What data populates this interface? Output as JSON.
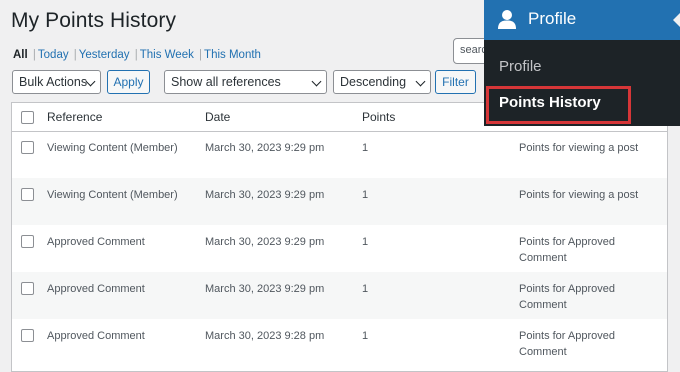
{
  "page": {
    "title": "My Points History"
  },
  "filters": {
    "current": "All",
    "links": [
      "Today",
      "Yesterday",
      "This Week",
      "This Month"
    ]
  },
  "search": {
    "placeholder": "search"
  },
  "toolbar": {
    "bulk_actions": "Bulk Actions",
    "apply": "Apply",
    "reference_filter": "Show all references",
    "order": "Descending",
    "filter": "Filter"
  },
  "table": {
    "columns": {
      "reference": "Reference",
      "date": "Date",
      "points": "Points"
    },
    "rows": [
      {
        "reference": "Viewing Content (Member)",
        "date": "March 30, 2023 9:29 pm",
        "points": "1",
        "desc": "Points for viewing a post"
      },
      {
        "reference": "Viewing Content (Member)",
        "date": "March 30, 2023 9:29 pm",
        "points": "1",
        "desc": "Points for viewing a post"
      },
      {
        "reference": "Approved Comment",
        "date": "March 30, 2023 9:29 pm",
        "points": "1",
        "desc": "Points for Approved Comment"
      },
      {
        "reference": "Approved Comment",
        "date": "March 30, 2023 9:29 pm",
        "points": "1",
        "desc": "Points for Approved Comment"
      },
      {
        "reference": "Approved Comment",
        "date": "March 30, 2023 9:28 pm",
        "points": "1",
        "desc": "Points for Approved Comment"
      }
    ]
  },
  "menu": {
    "header": "Profile",
    "header_icon": "user-icon",
    "items": [
      "Profile",
      "Points History"
    ],
    "current": "Points History",
    "colors": {
      "menu_bg": "#1d2327",
      "header_bg": "#2271b1",
      "highlight": "#d63638"
    }
  }
}
